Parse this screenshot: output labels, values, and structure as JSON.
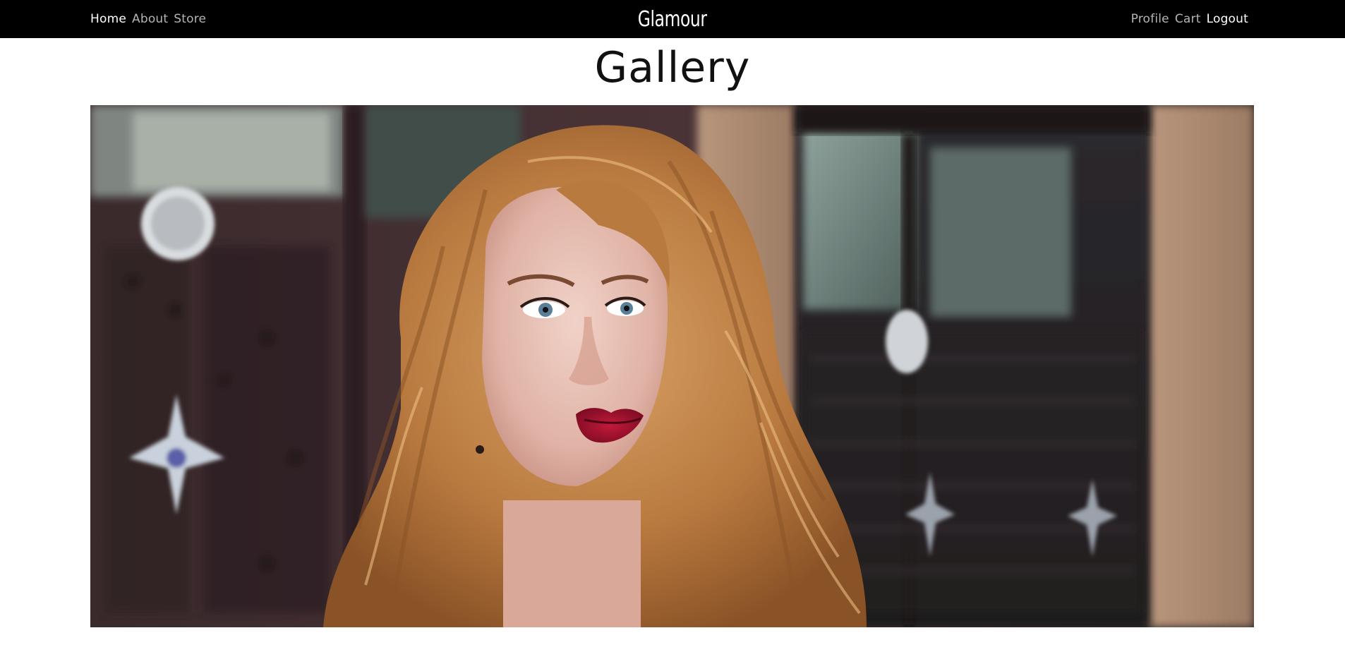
{
  "nav": {
    "left": [
      {
        "label": "Home",
        "active": true
      },
      {
        "label": "About",
        "active": false
      },
      {
        "label": "Store",
        "active": false
      }
    ],
    "brand": "Glamour",
    "right": [
      {
        "label": "Profile",
        "active": false
      },
      {
        "label": "Cart",
        "active": false
      },
      {
        "label": "Logout",
        "active": true
      }
    ]
  },
  "page": {
    "title": "Gallery"
  },
  "gallery": {
    "image_subject": "portrait of a woman with wavy auburn hair and red lipstick in front of a dark ornate door"
  },
  "colors": {
    "navbar_bg": "#000000",
    "nav_active": "#ffffff",
    "nav_inactive": "#b4b4b4",
    "page_bg": "#ffffff"
  }
}
